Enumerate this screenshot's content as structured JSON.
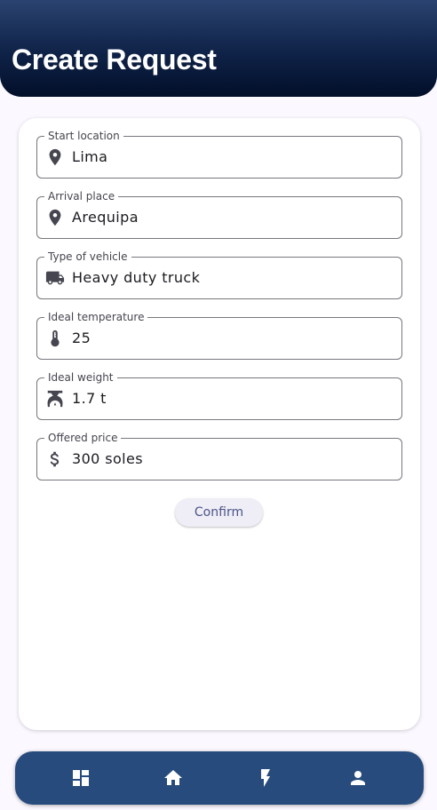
{
  "header": {
    "title": "Create Request"
  },
  "form": {
    "fields": [
      {
        "label": "Start location",
        "value": "Lima",
        "icon": "location-pin-icon"
      },
      {
        "label": "Arrival place",
        "value": "Arequipa",
        "icon": "location-pin-icon"
      },
      {
        "label": "Type of vehicle",
        "value": "Heavy duty truck",
        "icon": "truck-icon"
      },
      {
        "label": "Ideal temperature",
        "value": "25",
        "icon": "thermometer-icon"
      },
      {
        "label": "Ideal weight",
        "value": "1.7 t",
        "icon": "scale-icon"
      },
      {
        "label": "Offered price",
        "value": "300 soles",
        "icon": "dollar-icon"
      }
    ],
    "confirm_label": "Confirm"
  },
  "bottom_nav": {
    "items": [
      {
        "icon": "dashboard-icon"
      },
      {
        "icon": "home-icon"
      },
      {
        "icon": "bolt-icon"
      },
      {
        "icon": "person-icon"
      }
    ]
  },
  "colors": {
    "header_top": "#2a4370",
    "header_bottom": "#020f2a",
    "nav_background": "#264b7c",
    "page_background": "#fbf8ff",
    "icon_dark": "#45464f",
    "button_text": "#4c5587"
  }
}
